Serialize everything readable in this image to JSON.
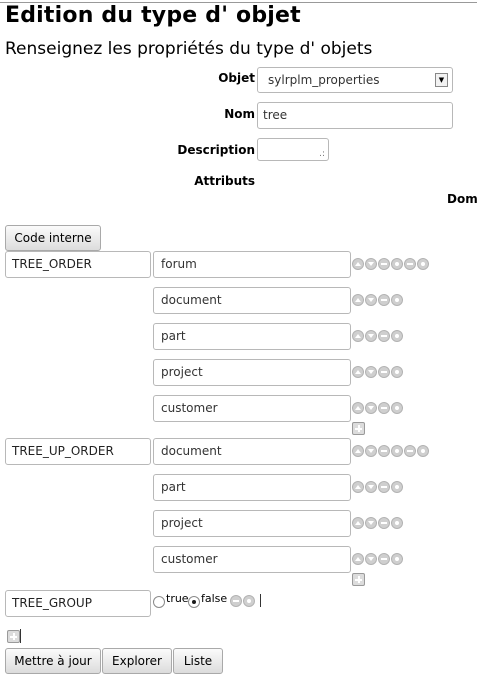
{
  "page": {
    "title": "Edition du type d' objet",
    "subtitle": "Renseignez les propriétés du type d' objets"
  },
  "form": {
    "objet_label": "Objet",
    "objet_value": "sylrplm_properties",
    "nom_label": "Nom",
    "nom_value": "tree",
    "description_label": "Description",
    "description_value": "",
    "attributs_label": "Attributs",
    "domaine_label": "Dom"
  },
  "attributes": {
    "code_interne_button": "Code interne",
    "rows": [
      {
        "key": "TREE_ORDER",
        "values": [
          "forum",
          "document",
          "part",
          "project",
          "customer"
        ]
      },
      {
        "key": "TREE_UP_ORDER",
        "values": [
          "document",
          "part",
          "project",
          "customer"
        ]
      },
      {
        "key": "TREE_GROUP",
        "radio": {
          "options": [
            "true",
            "false"
          ],
          "selected": "false"
        }
      }
    ]
  },
  "icons": {
    "move_up": "arrow-up-icon",
    "move_down": "arrow-down-icon",
    "remove": "minus-icon",
    "delete": "delete-icon",
    "add": "plus-icon"
  },
  "actions": {
    "update": "Mettre à jour",
    "explore": "Explorer",
    "list": "Liste"
  }
}
